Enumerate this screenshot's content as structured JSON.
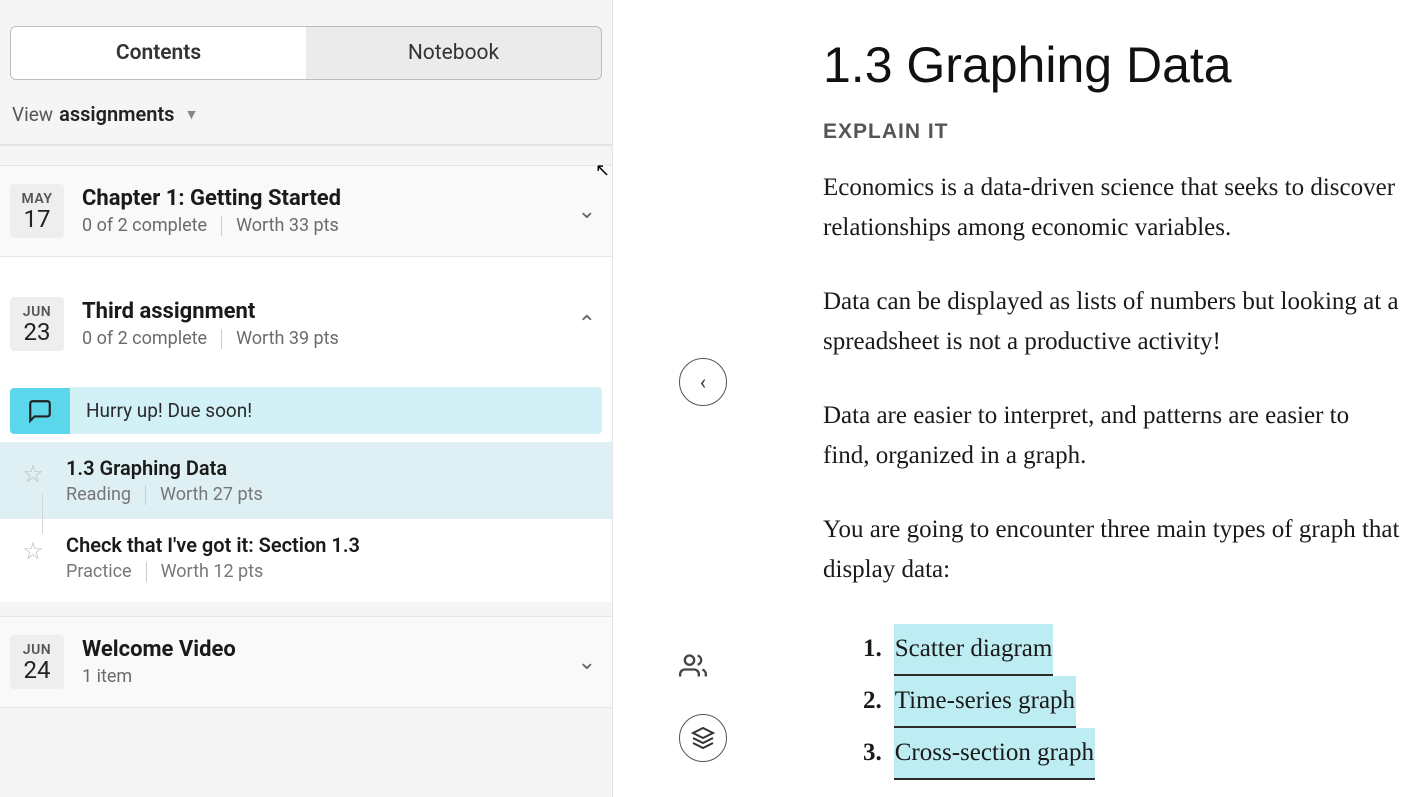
{
  "tabs": {
    "contents": "Contents",
    "notebook": "Notebook"
  },
  "view": {
    "label": "View",
    "value": "assignments"
  },
  "assignments": [
    {
      "month": "MAY",
      "day": "17",
      "title": "Chapter 1: Getting Started",
      "progress": "0 of 2 complete",
      "worth": "Worth 33 pts",
      "expanded": false
    },
    {
      "month": "JUN",
      "day": "23",
      "title": "Third assignment",
      "progress": "0 of 2 complete",
      "worth": "Worth 39 pts",
      "expanded": true
    },
    {
      "month": "JUN",
      "day": "24",
      "title": "Welcome Video",
      "progress": "1 item",
      "worth": "",
      "expanded": false
    }
  ],
  "alert": {
    "text": "Hurry up! Due soon!"
  },
  "items": [
    {
      "title": "1.3 Graphing Data",
      "type": "Reading",
      "worth": "Worth 27 pts",
      "active": true
    },
    {
      "title": "Check that I've got it: Section 1.3",
      "type": "Practice",
      "worth": "Worth 12 pts",
      "active": false
    }
  ],
  "content": {
    "heading": "1.3 Graphing Data",
    "subhead": "EXPLAIN IT",
    "p1": "Economics is a data-driven science that seeks to discover relationships among economic variables.",
    "p2": "Data can be displayed as lists of numbers but looking at a spreadsheet is not a productive activity!",
    "p3": "Data are easier to interpret, and patterns are easier to find, organized in a graph.",
    "p4": "You are going to encounter three main types of graph that display data:",
    "list": [
      "Scatter diagram",
      "Time-series graph",
      "Cross-section graph"
    ]
  }
}
